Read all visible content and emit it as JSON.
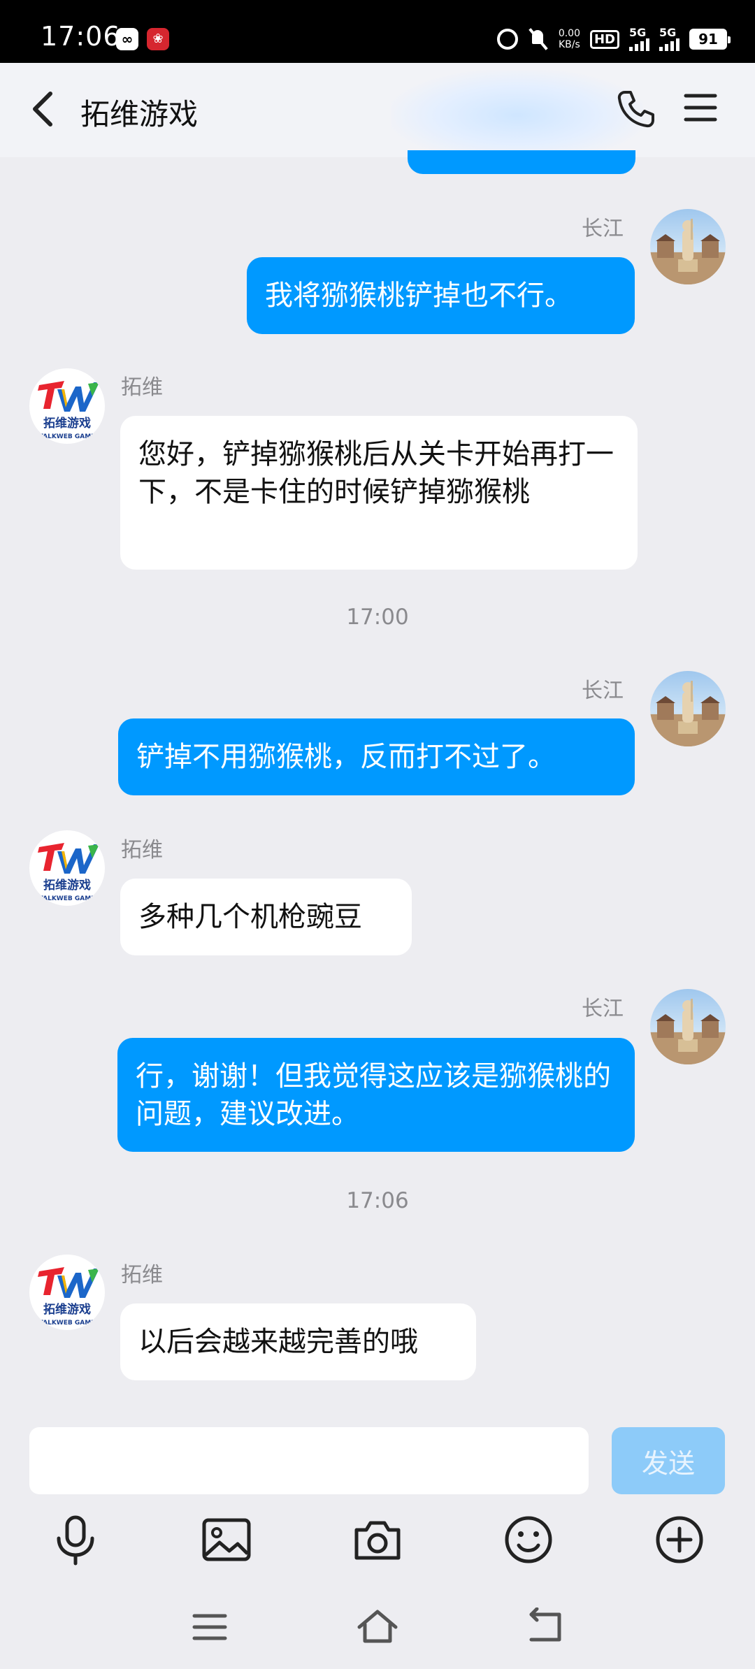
{
  "status_bar": {
    "time": "17:06",
    "app_icon_1": "∞",
    "app_icon_2": "❀",
    "net_speed_value": "0.00",
    "net_speed_unit": "KB/s",
    "hd_badge": "HD",
    "network_1": "5G",
    "network_2": "5G",
    "battery": "91"
  },
  "header": {
    "title": "拓维游戏"
  },
  "messages": [
    {
      "sender": "长江",
      "text": "我将猕猴桃铲掉也不行。"
    },
    {
      "sender": "拓维",
      "text": "您好，铲掉猕猴桃后从关卡开始再打一下，不是卡住的时候铲掉猕猴桃"
    },
    {
      "timestamp": "17:00"
    },
    {
      "sender": "长江",
      "text": "铲掉不用猕猴桃，反而打不过了。"
    },
    {
      "sender": "拓维",
      "text": "多种几个机枪豌豆"
    },
    {
      "sender": "长江",
      "text": "行，谢谢！但我觉得这应该是猕猴桃的问题，建议改进。"
    },
    {
      "timestamp": "17:06"
    },
    {
      "sender": "拓维",
      "text": "以后会越来越完善的哦"
    }
  ],
  "bot_logo": {
    "mark": "TW",
    "name": "拓维游戏",
    "sub": "TALKWEB GAME"
  },
  "input": {
    "value": "",
    "placeholder": "",
    "send_label": "发送"
  },
  "toolbar_icons": [
    "microphone-icon",
    "image-icon",
    "camera-icon",
    "emoji-icon",
    "plus-icon"
  ],
  "nav_icons": [
    "menu-icon",
    "home-icon",
    "back-icon"
  ],
  "colors": {
    "accent": "#0099ff",
    "send_disabled": "#8dcbf9",
    "background": "#ededf1"
  }
}
